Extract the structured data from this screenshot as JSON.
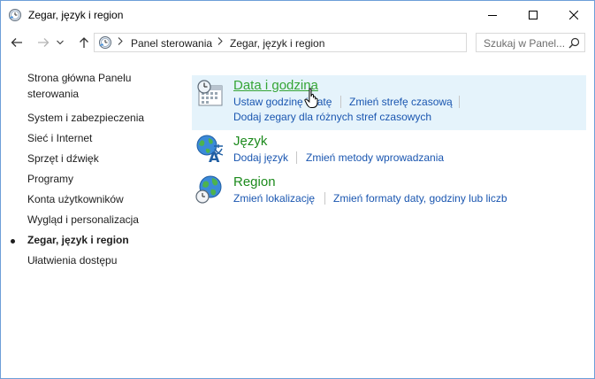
{
  "window": {
    "title": "Zegar, język i region"
  },
  "nav": {
    "breadcrumb": [
      "Panel sterowania",
      "Zegar, język i region"
    ],
    "search_placeholder": "Szukaj w Panel..."
  },
  "sidebar": {
    "home_line1": "Strona główna Panelu",
    "home_line2": "sterowania",
    "items": [
      {
        "label": "System i zabezpieczenia"
      },
      {
        "label": "Sieć i Internet"
      },
      {
        "label": "Sprzęt i dźwięk"
      },
      {
        "label": "Programy"
      },
      {
        "label": "Konta użytkowników"
      },
      {
        "label": "Wygląd i personalizacja"
      },
      {
        "label": "Zegar, język i region",
        "current": true
      },
      {
        "label": "Ułatwienia dostępu"
      }
    ]
  },
  "categories": [
    {
      "icon": "date-time-icon",
      "title": "Data i godzina",
      "links_row1": [
        "Ustaw godzinę i datę",
        "Zmień strefę czasową"
      ],
      "links_row2": [
        "Dodaj zegary dla różnych stref czasowych"
      ]
    },
    {
      "icon": "language-icon",
      "title": "Język",
      "links_row1": [
        "Dodaj język",
        "Zmień metody wprowadzania"
      ]
    },
    {
      "icon": "region-globe-icon",
      "title": "Region",
      "links_row1": [
        "Zmień lokalizację",
        "Zmień formaty daty, godziny lub liczb"
      ]
    }
  ],
  "colors": {
    "category_title": "#1c8a1c",
    "link": "#1a56b0",
    "hover_background": "#e5f3fb"
  }
}
